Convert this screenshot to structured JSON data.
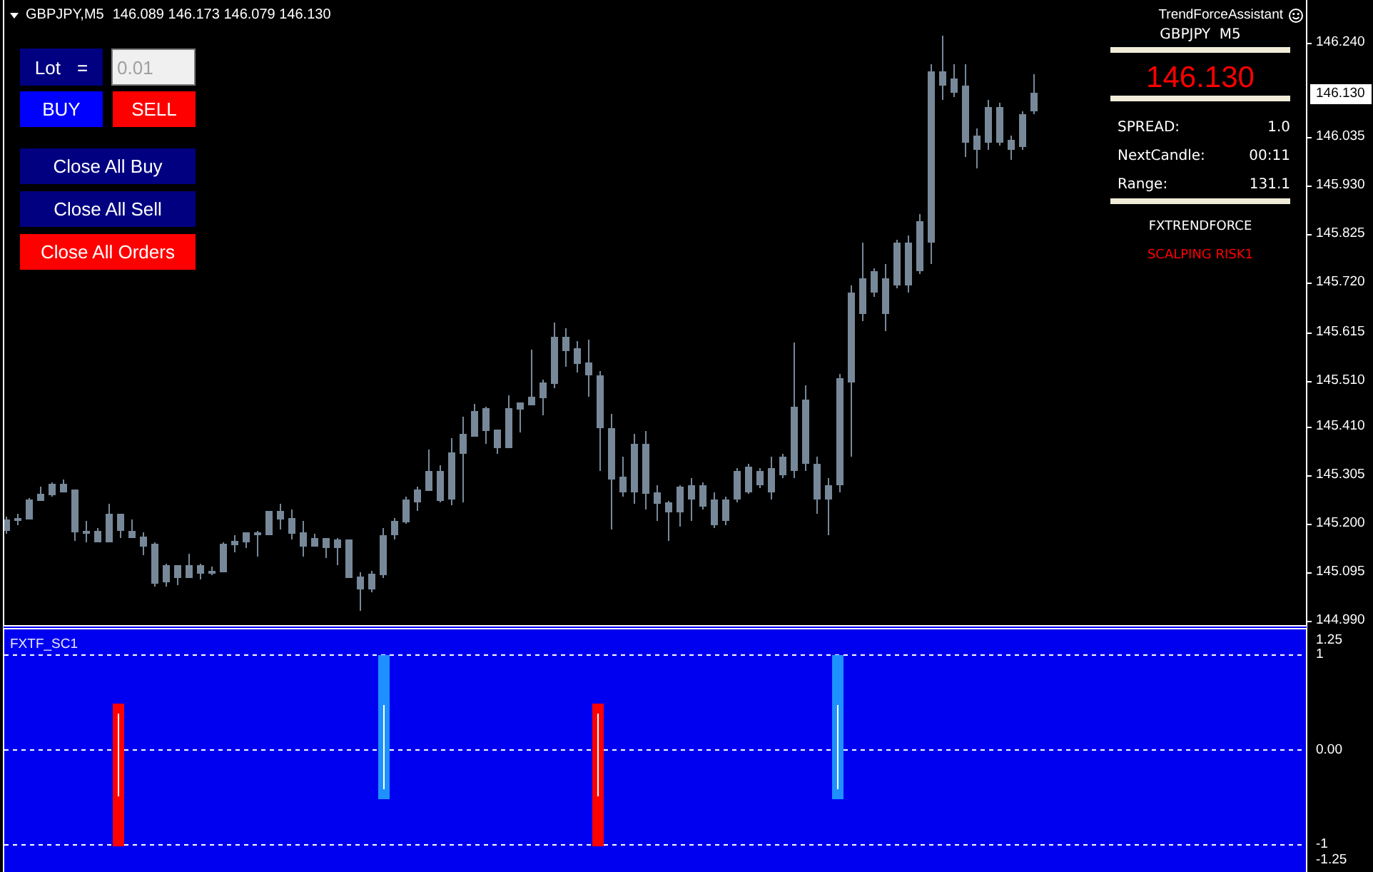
{
  "chart_header": {
    "symbol": "GBPJPY,M5",
    "ohlc": "146.089 146.173 146.079 146.130"
  },
  "trade_panel": {
    "lot_label": "Lot =",
    "lot_field": {
      "value": "0.01"
    },
    "order_buttons": [
      {
        "label": "BUY",
        "kind": "buy"
      },
      {
        "label": "SELL",
        "kind": "sell"
      }
    ],
    "close_buttons": [
      {
        "label": "Close All Buy",
        "kind": "close"
      },
      {
        "label": "Close All Sell",
        "kind": "close"
      },
      {
        "label": "Close All Orders",
        "kind": "danger"
      }
    ]
  },
  "info_panel": {
    "title": "TrendForceAssistant",
    "symbol": "GBPJPY M5",
    "price": "146.130",
    "stats": [
      {
        "label": "SPREAD:",
        "value": "1.0"
      },
      {
        "label": "NextCandle:",
        "value": "00:11"
      },
      {
        "label": "Range:",
        "value": "131.1"
      }
    ],
    "brand": "FXTRENDFORCE",
    "mode": "SCALPING RISK1"
  },
  "price_axis": {
    "labels": [
      "146.240",
      "146.035",
      "145.930",
      "145.825",
      "145.720",
      "145.615",
      "145.510",
      "145.410",
      "145.305",
      "145.200",
      "145.095",
      "144.990"
    ],
    "current_price": "146.130"
  },
  "indicator": {
    "name": "FXTF_SC1",
    "axis_labels": [
      "1.25",
      "1",
      "0.00",
      "-1",
      "-1.25"
    ]
  }
}
